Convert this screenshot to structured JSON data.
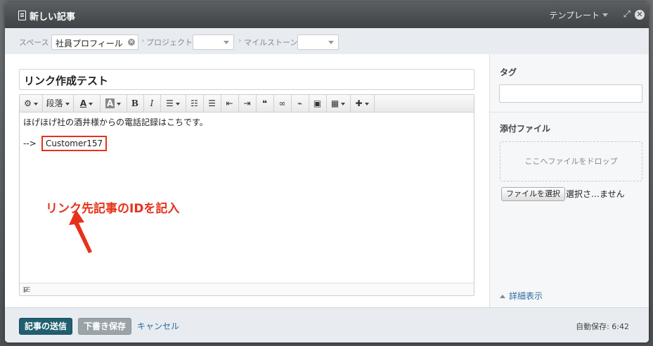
{
  "window": {
    "title": "新しい記事",
    "template_label": "テンプレート"
  },
  "filters": {
    "space_label": "スペース",
    "space_value": "社員プロフィール",
    "project_label": "プロジェクト",
    "milestone_label": "マイルストーン"
  },
  "editor": {
    "title": "リンク作成テスト",
    "toolbar": {
      "paragraph": "段落",
      "bold": "B",
      "italic": "I",
      "text_color": "A",
      "bg_color": "A"
    },
    "line1": "ほげほげ社の酒井様からの電話記録はこちです。",
    "line2_prefix": "-->",
    "link_id": "Customer157",
    "status_path": "p"
  },
  "annotation": {
    "text": "リンク先記事のIDを記入",
    "color": "#e8311b"
  },
  "sidebar": {
    "tag_label": "タグ",
    "attachment_label": "添付ファイル",
    "dropzone_text": "ここへファイルをドロップ",
    "file_button": "ファイルを選択",
    "no_file_text": "選択さ…ません",
    "detail_link": "詳細表示"
  },
  "footer": {
    "send_button": "記事の送信",
    "draft_button": "下書き保存",
    "cancel_link": "キャンセル",
    "autosave": "自動保存: 6:42"
  }
}
